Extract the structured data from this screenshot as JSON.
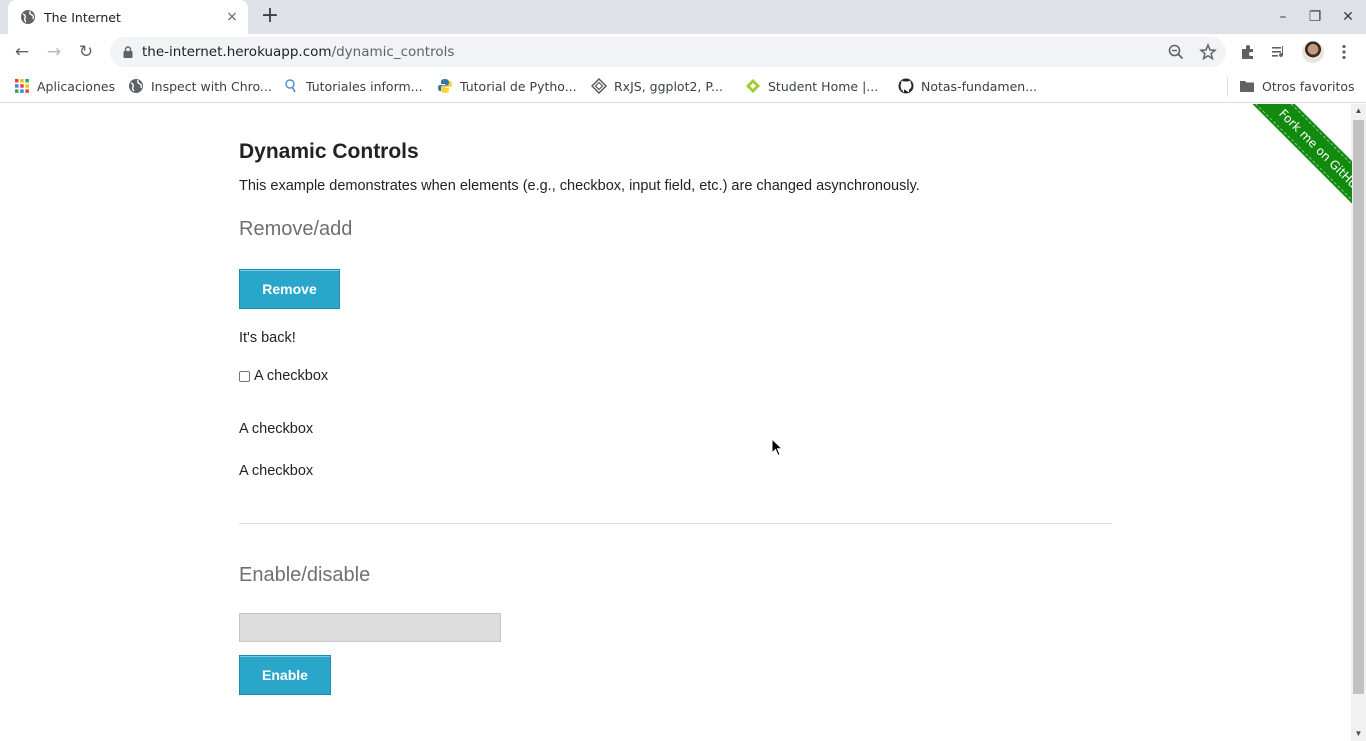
{
  "browser": {
    "tab": {
      "title": "The Internet",
      "close_icon": "×"
    },
    "new_tab_icon": "+",
    "window_controls": {
      "minimize": "–",
      "restore": "❐",
      "close": "✕"
    },
    "nav": {
      "back": "←",
      "forward": "→",
      "reload": "↻"
    },
    "url": {
      "host": "the-internet.herokuapp.com",
      "path": "/dynamic_controls"
    },
    "bookmarks": [
      {
        "label": "Aplicaciones",
        "icon": "apps-grid-icon"
      },
      {
        "label": "Inspect with Chro...",
        "icon": "globe-icon"
      },
      {
        "label": "Tutoriales inform...",
        "icon": "lightbulb-icon"
      },
      {
        "label": "Tutorial de Pytho...",
        "icon": "python-icon"
      },
      {
        "label": "RxJS, ggplot2, P...",
        "icon": "diamond-icon"
      },
      {
        "label": "Student Home |...",
        "icon": "green-diamond-icon"
      },
      {
        "label": "Notas-fundamen...",
        "icon": "github-icon"
      }
    ],
    "other_bookmarks": "Otros favoritos"
  },
  "page": {
    "title": "Dynamic Controls",
    "description": "This example demonstrates when elements (e.g., checkbox, input field, etc.) are changed asynchronously.",
    "remove_add": {
      "heading": "Remove/add",
      "button_label": "Remove",
      "message": "It's back!",
      "checkbox_label": "A checkbox",
      "extra_labels": [
        "A checkbox",
        "A checkbox"
      ]
    },
    "enable_disable": {
      "heading": "Enable/disable",
      "input_value": "",
      "button_label": "Enable"
    },
    "ribbon_text": "Fork me on GitHub"
  },
  "colors": {
    "button": "#2ba6cb",
    "ribbon": "#118a0f"
  }
}
